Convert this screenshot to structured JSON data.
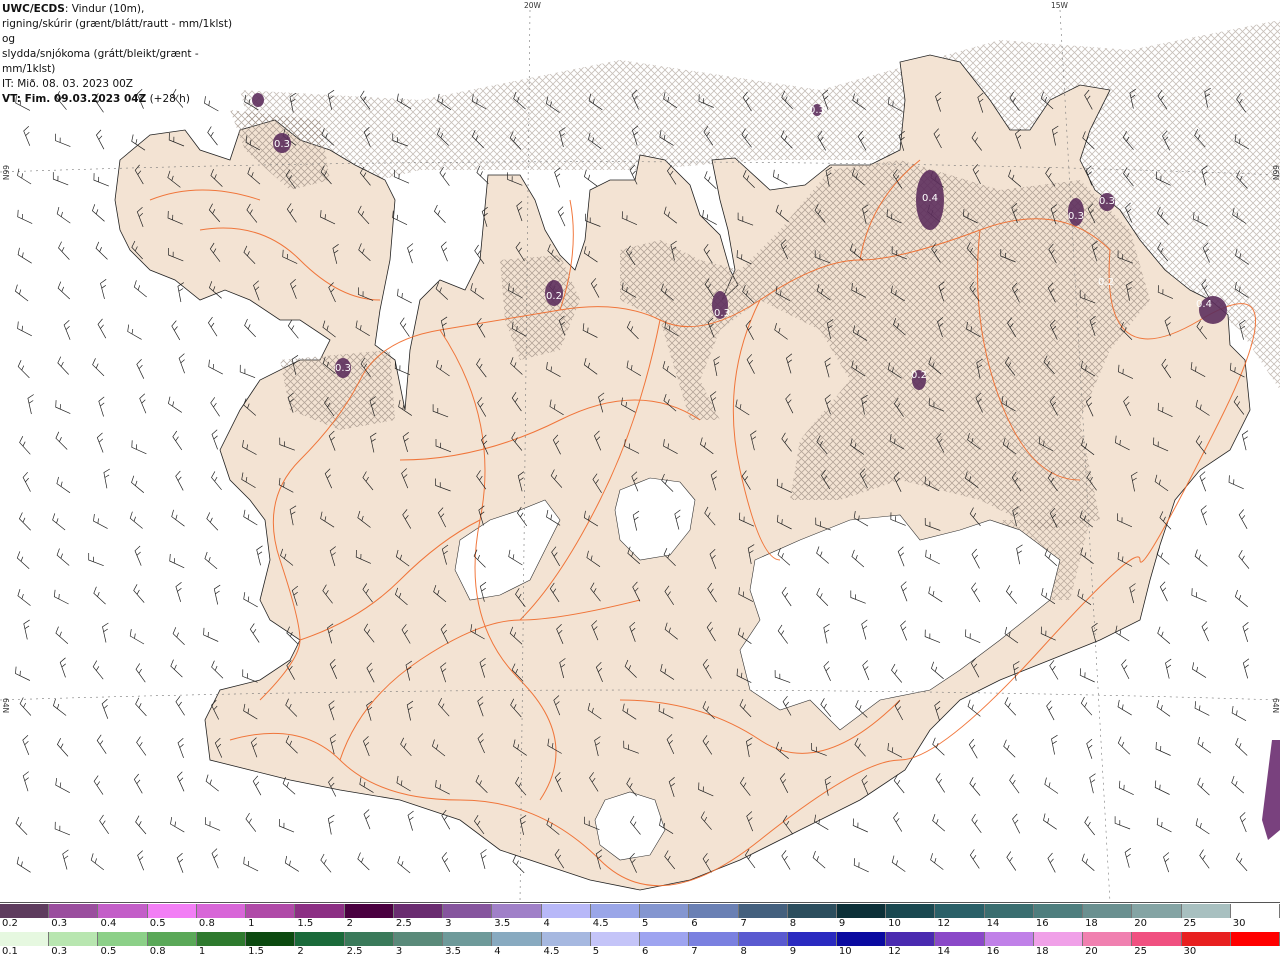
{
  "header": {
    "line1_bold": "UWC/ECDS",
    "line1_rest": ": Vindur (10m),",
    "line2": "rigning/skúrir (grænt/blátt/rautt - mm/1klst) og",
    "line3": "slydda/snjókoma (grátt/bleikt/grænt - mm/1klst)",
    "line4": "IT: Mið. 08. 03. 2023 00Z",
    "line5_bold": "VT: Fim. 09.03.2023 04Z",
    "line5_rest": " (+28 h)"
  },
  "graticule": {
    "lon_labels": [
      "20W",
      "15W"
    ],
    "lat_labels": [
      "66N",
      "64N",
      "66N",
      "64N"
    ]
  },
  "precip_labels": [
    "0.3",
    "0.3",
    "0.2",
    "0.3",
    "0.3",
    "0.2",
    "0.4",
    "0.3",
    "0.3",
    "0.2",
    "0.4"
  ],
  "colors": {
    "land": "#f3e3d3",
    "road": "#f06a2a",
    "hatch": "#9a8b80",
    "sea": "#ffffff",
    "glacier": "#ffffff",
    "precip_spot": "#5d2f5d"
  },
  "snow_scale": {
    "labels": [
      "0.2",
      "0.3",
      "0.4",
      "0.5",
      "0.8",
      "1",
      "1.5",
      "2",
      "2.5",
      "3",
      "3.5",
      "4",
      "4.5",
      "5",
      "6",
      "7",
      "8",
      "9",
      "10",
      "12",
      "14",
      "16",
      "18",
      "20",
      "25",
      "30"
    ],
    "colors": [
      "#5e3c5e",
      "#9a4e9e",
      "#c35ec8",
      "#f27ef5",
      "#d866d8",
      "#b04aa8",
      "#8c2f84",
      "#4a0040",
      "#6a2c70",
      "#86559e",
      "#a080c8",
      "#b8b8f8",
      "#9aa6e8",
      "#8496d0",
      "#6a80b4",
      "#44607e",
      "#2c4e5e",
      "#0c3038",
      "#1a4850",
      "#2a6068",
      "#3a6e70",
      "#4e7e7e",
      "#6a9090",
      "#84a4a4",
      "#a8c0c0",
      "#ffffff"
    ]
  },
  "rain_scale": {
    "labels": [
      "0.1",
      "0.3",
      "0.5",
      "0.8",
      "1",
      "1.5",
      "2",
      "2.5",
      "3",
      "3.5",
      "4",
      "4.5",
      "5",
      "6",
      "7",
      "8",
      "9",
      "10",
      "12",
      "14",
      "16",
      "18",
      "20",
      "25",
      "30"
    ],
    "colors": [
      "#e6f8e0",
      "#b8e6b0",
      "#8cd088",
      "#5aa858",
      "#2e7a2e",
      "#0c4a10",
      "#1a6a3a",
      "#3a7a5a",
      "#5a8a7a",
      "#6e9a9a",
      "#88aac0",
      "#a6b8e0",
      "#c4c4f8",
      "#9ea4f0",
      "#7a80e0",
      "#5a5ad0",
      "#2a2ac0",
      "#0a0aa0",
      "#4a2ab0",
      "#8a48c8",
      "#c080e8",
      "#f0a0e8",
      "#f080b0",
      "#f05080",
      "#e82020",
      "#ff0000"
    ]
  }
}
